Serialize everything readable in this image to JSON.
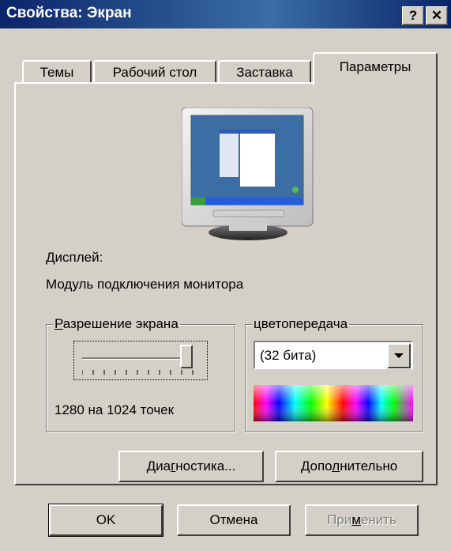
{
  "window": {
    "title": "Свойства: Экран",
    "help_button": "?",
    "close_button": "✕"
  },
  "tabs": [
    {
      "label": "Темы"
    },
    {
      "label": "Рабочий стол"
    },
    {
      "label": "Заставка"
    },
    {
      "label": "Параметры",
      "active": true
    }
  ],
  "display": {
    "label": "Дисплей:",
    "value": "Модуль подключения монитора"
  },
  "resolution": {
    "group_label_pre": "",
    "group_label_ul": "Р",
    "group_label_post": "азрешение экрана",
    "value_text": "1280 на 1024 точек",
    "slider_level": 1.0
  },
  "color": {
    "group_label": "цветопередача",
    "selected": "(32 бита)"
  },
  "buttons": {
    "troubleshoot_pre": "Диа",
    "troubleshoot_ul": "г",
    "troubleshoot_post": "ностика...",
    "advanced_pre": "Допо",
    "advanced_ul": "л",
    "advanced_post": "нительно",
    "ok": "OK",
    "cancel": "Отмена",
    "apply_pre": "При",
    "apply_ul": "м",
    "apply_post": "енить"
  },
  "icons": [
    "help-icon",
    "close-icon",
    "monitor-preview-icon",
    "dropdown-arrow-icon"
  ],
  "colors": {
    "titlebar": "#0a246a",
    "face": "#d4d0c8",
    "desktop_preview": "#3a6ea5"
  }
}
